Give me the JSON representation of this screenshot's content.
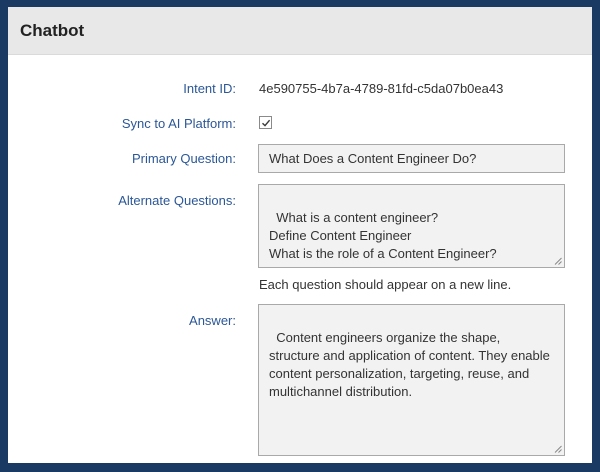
{
  "panel": {
    "title": "Chatbot"
  },
  "form": {
    "intent_id": {
      "label": "Intent ID:",
      "value": "4e590755-4b7a-4789-81fd-c5da07b0ea43"
    },
    "sync": {
      "label": "Sync to AI Platform:",
      "checked": true
    },
    "primary_question": {
      "label": "Primary Question:",
      "value": "What Does a Content Engineer Do?"
    },
    "alternate_questions": {
      "label": "Alternate Questions:",
      "value": "What is a content engineer?\nDefine Content Engineer\nWhat is the role of a Content Engineer?",
      "hint": "Each question should appear on a new line."
    },
    "answer": {
      "label": "Answer:",
      "value": "Content engineers organize the shape, structure and application of content. They enable content personalization, targeting, reuse, and multichannel distribution."
    }
  },
  "colors": {
    "background": "#1b3a63",
    "label": "#2b5797",
    "header": "#e8e8e8",
    "field": "#f2f2f2"
  }
}
